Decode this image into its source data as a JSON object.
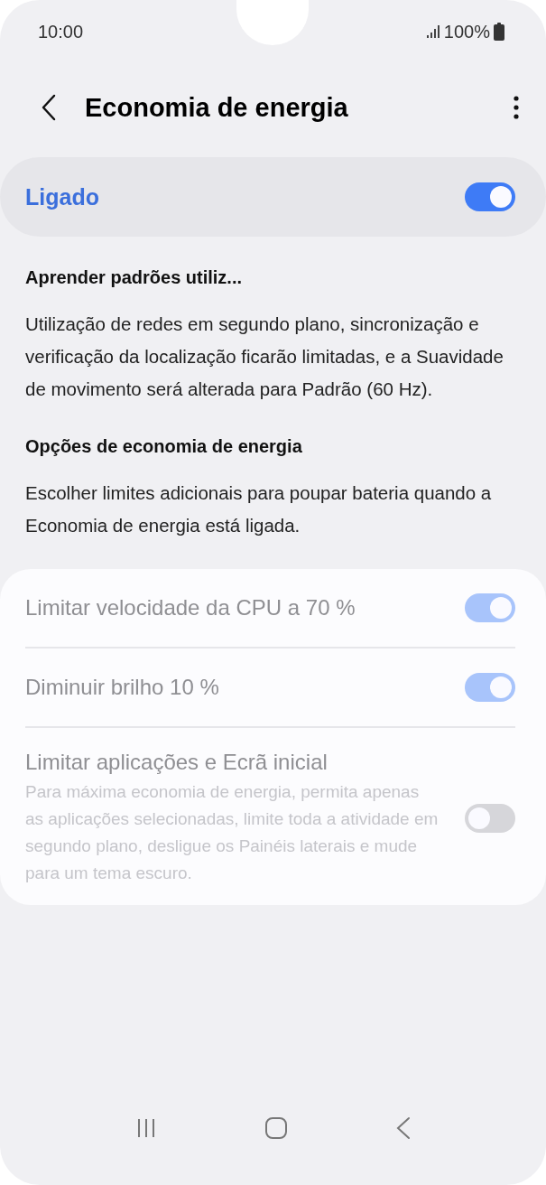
{
  "status_bar": {
    "time": "10:00",
    "battery": "100%"
  },
  "header": {
    "title": "Economia de energia"
  },
  "master_switch": {
    "label": "Ligado",
    "on": true
  },
  "sections": [
    {
      "title": "Aprender padrões utiliz...",
      "text": "Utilização de redes em segundo plano, sincronização e verificação da localização ficarão limitadas, e a Suavidade de movimento será alterada para Padrão (60 Hz)."
    },
    {
      "title": "Opções de economia de energia",
      "text": "Escolher limites adicionais para poupar bateria quando a Economia de energia está ligada."
    }
  ],
  "options": [
    {
      "label": "Limitar velocidade da CPU a 70 %",
      "on": true,
      "disabled": true
    },
    {
      "label": "Diminuir brilho 10 %",
      "on": true,
      "disabled": true
    },
    {
      "label": "Limitar aplicações e Ecrã inicial",
      "description": "Para máxima economia de energia, permita apenas as aplicações selecionadas, limite toda a atividade em segundo plano, desligue os Painéis laterais e mude para um tema escuro.",
      "on": false,
      "disabled": true
    }
  ]
}
